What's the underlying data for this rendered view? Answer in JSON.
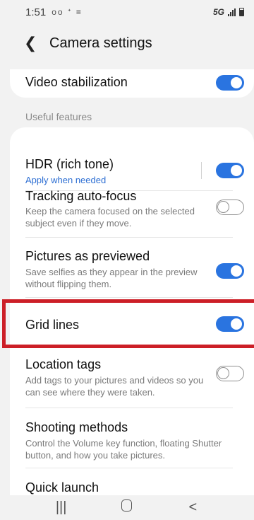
{
  "status_bar": {
    "time": "1:51",
    "left_icons": "ᴏᴏ ᕀ ≡",
    "network": "5G"
  },
  "header": {
    "title": "Camera settings"
  },
  "settings": {
    "video_stabilization": {
      "title": "Video stabilization",
      "enabled": true
    },
    "section_label": "Useful features",
    "hdr": {
      "title": "HDR (rich tone)",
      "subtitle": "Apply when needed",
      "enabled": true
    },
    "tracking": {
      "title": "Tracking auto-focus",
      "subtitle": "Keep the camera focused on the selected subject even if they move.",
      "enabled": false
    },
    "previewed": {
      "title": "Pictures as previewed",
      "subtitle": "Save selfies as they appear in the preview without flipping them.",
      "enabled": true
    },
    "grid": {
      "title": "Grid lines",
      "enabled": true
    },
    "location": {
      "title": "Location tags",
      "subtitle": "Add tags to your pictures and videos so you can see where they were taken.",
      "enabled": false
    },
    "shooting": {
      "title": "Shooting methods",
      "subtitle": "Control the Volume key function, floating Shutter button, and how you take pictures."
    },
    "quick_launch": {
      "title": "Quick launch"
    }
  },
  "nav": {
    "recents_glyph": "|||",
    "back_glyph": "<"
  },
  "colors": {
    "accent": "#2a74e0",
    "highlight": "#cc1f27",
    "background": "#f2f2f2"
  }
}
